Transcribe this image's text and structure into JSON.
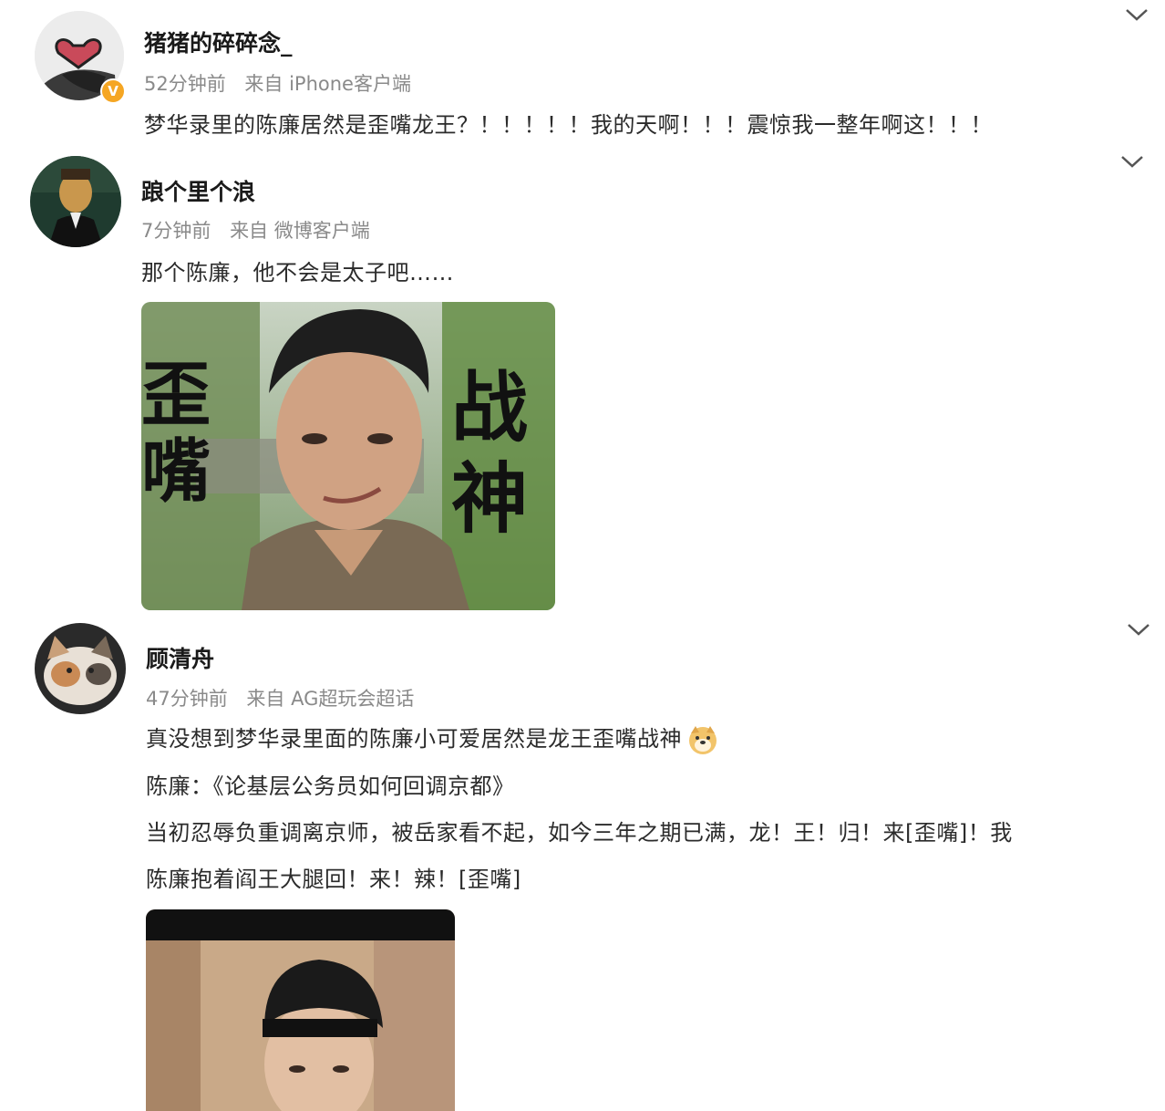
{
  "posts": [
    {
      "name": "猪猪的碎碎念_",
      "time": "52分钟前",
      "source": "来自 iPhone客户端",
      "lines": [
        "梦华录里的陈廉居然是歪嘴龙王？！！！！！我的天啊！！！震惊我一整年啊这！！！"
      ],
      "verified_mark": "V"
    },
    {
      "name": "踉个里个浪",
      "time": "7分钟前",
      "source": "来自 微博客户端",
      "lines": [
        "那个陈廉，他不会是太子吧……"
      ],
      "image_captions": {
        "left": "歪嘴",
        "right": "战神"
      }
    },
    {
      "name": "顾清舟",
      "time": "47分钟前",
      "source": "来自 AG超玩会超话",
      "lines": [
        "真没想到梦华录里面的陈廉小可爱居然是龙王歪嘴战神",
        "陈廉：《论基层公务员如何回调京都》",
        "当初忍辱负重调离京师，被岳家看不起，如今三年之期已满，龙！王！归！来[歪嘴]！我",
        "陈廉抱着阎王大腿回！来！辣！[歪嘴]"
      ]
    }
  ],
  "icons": {
    "chevron": "chevron-down-icon",
    "emoji": "doge-emoji-icon"
  }
}
